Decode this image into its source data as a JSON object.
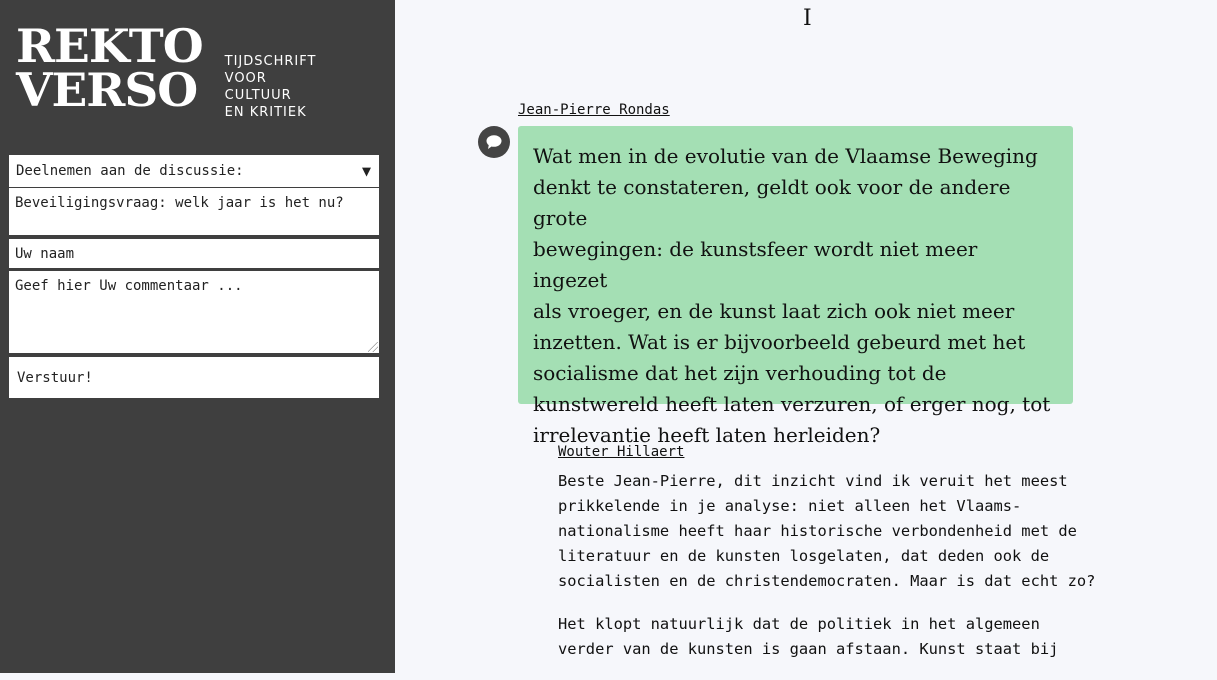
{
  "logo": {
    "line1": "REKTO",
    "line2": "VERSO",
    "sub": [
      "TIJDSCHRIFT",
      "VOOR",
      "CULTUUR",
      "EN KRITIEK"
    ]
  },
  "form": {
    "discussion_select": "Deelnemen aan de discussie:",
    "security_placeholder": "Beveiligingsvraag: welk jaar is het nu?",
    "name_placeholder": "Uw naam",
    "comment_placeholder": "Geef hier Uw commentaar ...",
    "submit_label": "Verstuur!"
  },
  "cursor": "I",
  "comments": [
    {
      "author": "Jean-Pierre Rondas",
      "lines": [
        "Wat men in de evolutie van de Vlaamse Beweging",
        "denkt te constateren, geldt ook voor de andere grote",
        "bewegingen: de kunstsfeer wordt niet meer ingezet",
        "als vroeger, en de kunst laat zich ook niet meer",
        "inzetten. Wat is er bijvoorbeeld gebeurd met het",
        "socialisme dat het zijn verhouding tot de",
        "kunstwereld heeft laten verzuren, of erger nog, tot",
        "irrelevantie heeft laten herleiden?"
      ]
    },
    {
      "author": "Wouter Hillaert",
      "paragraphs": [
        [
          "Beste Jean-Pierre, dit inzicht vind ik veruit het meest",
          "prikkelende in je analyse: niet alleen het Vlaams-",
          "nationalisme heeft haar historische verbondenheid met de",
          "literatuur en de kunsten losgelaten, dat deden ook de",
          "socialisten en de christendemocraten. Maar is dat echt zo?"
        ],
        [
          "Het klopt natuurlijk dat de politiek in het algemeen",
          "verder van de kunsten is gaan afstaan. Kunst staat bij"
        ]
      ]
    }
  ]
}
